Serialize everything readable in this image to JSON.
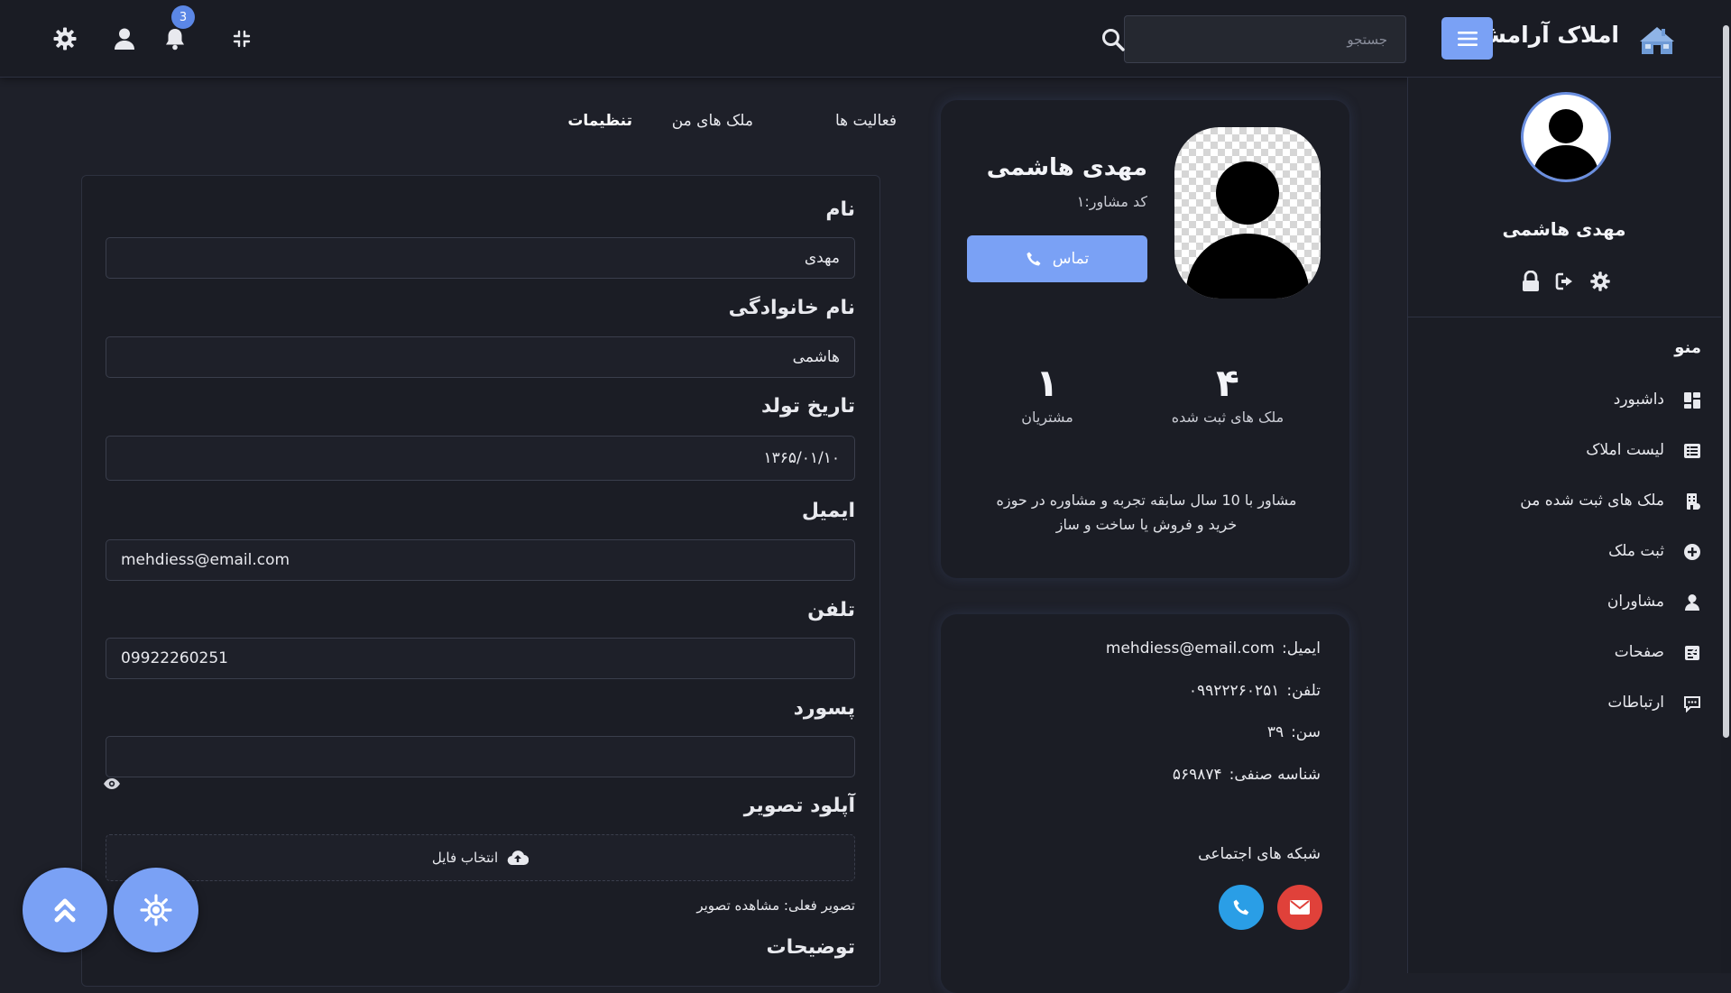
{
  "header": {
    "brand_title": "املاک آرامش",
    "search_placeholder": "جستجو",
    "notification_count": "3",
    "icons": [
      "logo-icon",
      "menu-icon",
      "search-icon",
      "compress-icon",
      "bell-icon",
      "user-icon",
      "gear-icon"
    ]
  },
  "sidebar": {
    "user_name": "مهدی هاشمی",
    "menu_title": "منو",
    "items": [
      {
        "label": "داشبورد",
        "icon": "dashboard-icon"
      },
      {
        "label": "لیست املاک",
        "icon": "list-icon"
      },
      {
        "label": "ملک های ثبت شده من",
        "icon": "building-icon"
      },
      {
        "label": "ثبت ملک",
        "icon": "plus-circle-icon"
      },
      {
        "label": "مشاوران",
        "icon": "users-icon",
        "has_submenu": true
      },
      {
        "label": "صفحات",
        "icon": "pages-icon",
        "has_submenu": true
      },
      {
        "label": "ارتباطات",
        "icon": "chat-icon"
      }
    ]
  },
  "profile": {
    "name": "مهدی هاشمی",
    "advisor_code": "کد مشاور:۱",
    "contact_label": "تماس",
    "stats": [
      {
        "value": "۴",
        "caption": "ملک های ثبت شده"
      },
      {
        "value": "۱",
        "caption": "مشتریان"
      }
    ],
    "description": "مشاور با 10 سال سابقه تجربه و مشاوره در حوزه خرید و فروش یا ساخت و ساز"
  },
  "info": {
    "email_key": "ایمیل:",
    "email_value": "mehdiess@email.com",
    "phone_key": "تلفن:",
    "phone_value": "۰۹۹۲۲۲۶۰۲۵۱",
    "age_key": "سن:",
    "age_value": "۳۹",
    "id_key": "شناسه صنفی:",
    "id_value": "۵۶۹۸۷۴",
    "social_title": "شبکه های اجتماعی"
  },
  "tabs": [
    "فعالیت ها",
    "ملک های من",
    "تنظیمات"
  ],
  "form": {
    "first_name_label": "نام",
    "first_name_value": "مهدی",
    "last_name_label": "نام خانوادگی",
    "last_name_value": "هاشمی",
    "birth_label": "تاریخ تولد",
    "birth_value": "۱۳۶۵/۰۱/۱۰",
    "email_label": "ایمیل",
    "email_value": "mehdiess@email.com",
    "phone_label": "تلفن",
    "phone_value": "09922260251",
    "password_label": "پسورد",
    "password_value": "",
    "upload_label": "آپلود تصویر",
    "choose_file_label": "انتخاب فایل",
    "current_image_label": "تصویر فعلی: مشاهده تصویر",
    "description_label": "توضیحات"
  },
  "colors": {
    "accent": "#7aa1f5",
    "background": "#1e2029",
    "card": "#1b1d25",
    "email_social": "#e0413a",
    "phone_social": "#2a9ee6"
  }
}
